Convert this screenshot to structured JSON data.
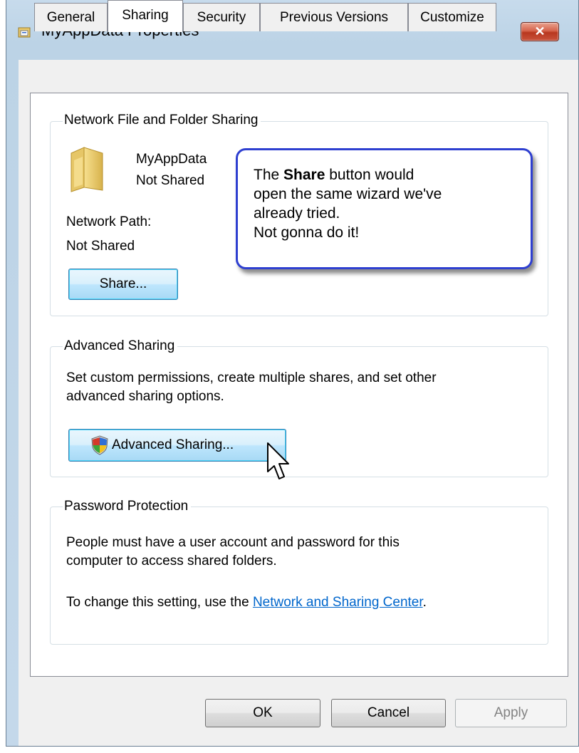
{
  "window": {
    "title": "MyAppData Properties",
    "close_label": "✕",
    "app_icon": "folder-properties-icon"
  },
  "tabs": [
    {
      "label": "General",
      "active": false
    },
    {
      "label": "Sharing",
      "active": true
    },
    {
      "label": "Security",
      "active": false
    },
    {
      "label": "Previous Versions",
      "active": false
    },
    {
      "label": "Customize",
      "active": false
    }
  ],
  "network_sharing": {
    "group_label": "Network File and Folder Sharing",
    "folder_name": "MyAppData",
    "folder_status": "Not Shared",
    "path_label": "Network Path:",
    "path_value": "Not Shared",
    "share_button": "Share...",
    "folder_icon": "folder-icon"
  },
  "callout": {
    "bold_word": "Share",
    "line1_prefix": "The",
    "line1_suffix": "button would",
    "line2": "open the same wizard we've",
    "line3": "already tried.",
    "line4": "Not gonna do it!"
  },
  "advanced_sharing": {
    "group_label": "Advanced Sharing",
    "description_line1": "Set custom permissions, create multiple shares, and set other",
    "description_line2": "advanced sharing options.",
    "button_label": "Advanced Sharing...",
    "button_icon": "uac-shield-icon"
  },
  "password_protection": {
    "group_label": "Password Protection",
    "line1": "People must have a user account and password for this",
    "line2": "computer to access shared folders.",
    "change_prefix": "To change this setting, use the",
    "link_text": "Network and Sharing Center",
    "change_suffix": "."
  },
  "buttons": {
    "ok": "OK",
    "cancel": "Cancel",
    "apply": "Apply"
  },
  "colors": {
    "callout_border": "#2e3fd0",
    "link": "#0066cc",
    "close_button": "#c9533b"
  }
}
